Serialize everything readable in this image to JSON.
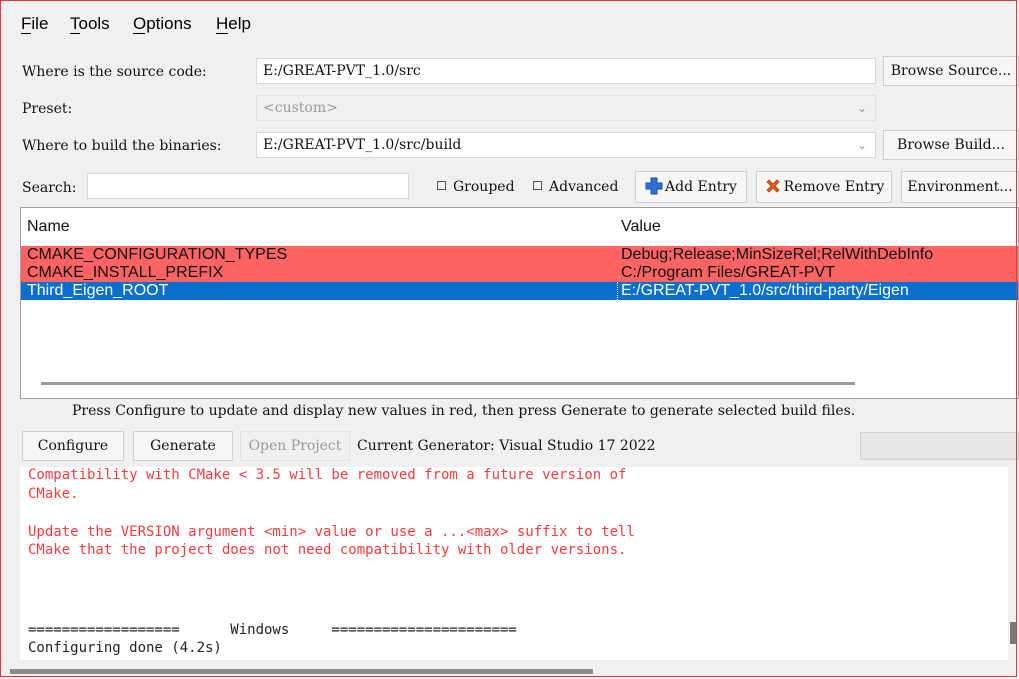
{
  "menu": {
    "file": "File",
    "tools": "Tools",
    "options": "Options",
    "help": "Help"
  },
  "source": {
    "label": "Where is the source code:",
    "value": "E:/GREAT-PVT_1.0/src",
    "browse_label": "Browse Source..."
  },
  "preset": {
    "label": "Preset:",
    "value": "<custom>"
  },
  "build": {
    "label": "Where to build the binaries:",
    "value": "E:/GREAT-PVT_1.0/src/build",
    "browse_label": "Browse Build..."
  },
  "search": {
    "label": "Search:",
    "value": ""
  },
  "options": {
    "grouped": "Grouped",
    "advanced": "Advanced"
  },
  "actions": {
    "add_entry": "Add Entry",
    "remove_entry": "Remove Entry",
    "environment": "Environment..."
  },
  "table": {
    "headers": [
      "Name",
      "Value"
    ],
    "rows": [
      {
        "name": "CMAKE_CONFIGURATION_TYPES",
        "value": "Debug;Release;MinSizeRel;RelWithDebInfo",
        "state": "new"
      },
      {
        "name": "CMAKE_INSTALL_PREFIX",
        "value": "C:/Program Files/GREAT-PVT",
        "state": "new"
      },
      {
        "name": "Third_Eigen_ROOT",
        "value": "E:/GREAT-PVT_1.0/src/third-party/Eigen",
        "state": "selected"
      }
    ]
  },
  "hint": "Press Configure to update and display new values in red, then press Generate to generate selected build files.",
  "bottom": {
    "configure": "Configure",
    "generate": "Generate",
    "open_project": "Open Project",
    "current_generator": "Current Generator: Visual Studio 17 2022"
  },
  "output": {
    "lines": [
      "Compatibility with CMake < 3.5 will be removed from a future version of",
      "CMake.",
      "",
      "Update the VERSION argument <min> value or use a ...<max> suffix to tell",
      "CMake that the project does not need compatibility with older versions.",
      "==================      Windows     ======================",
      "Configuring done (4.2s)"
    ]
  },
  "colors": {
    "changed_row": "#ff6464",
    "selected_row": "#0a70d0",
    "output_warning": "#ff3b3b"
  }
}
